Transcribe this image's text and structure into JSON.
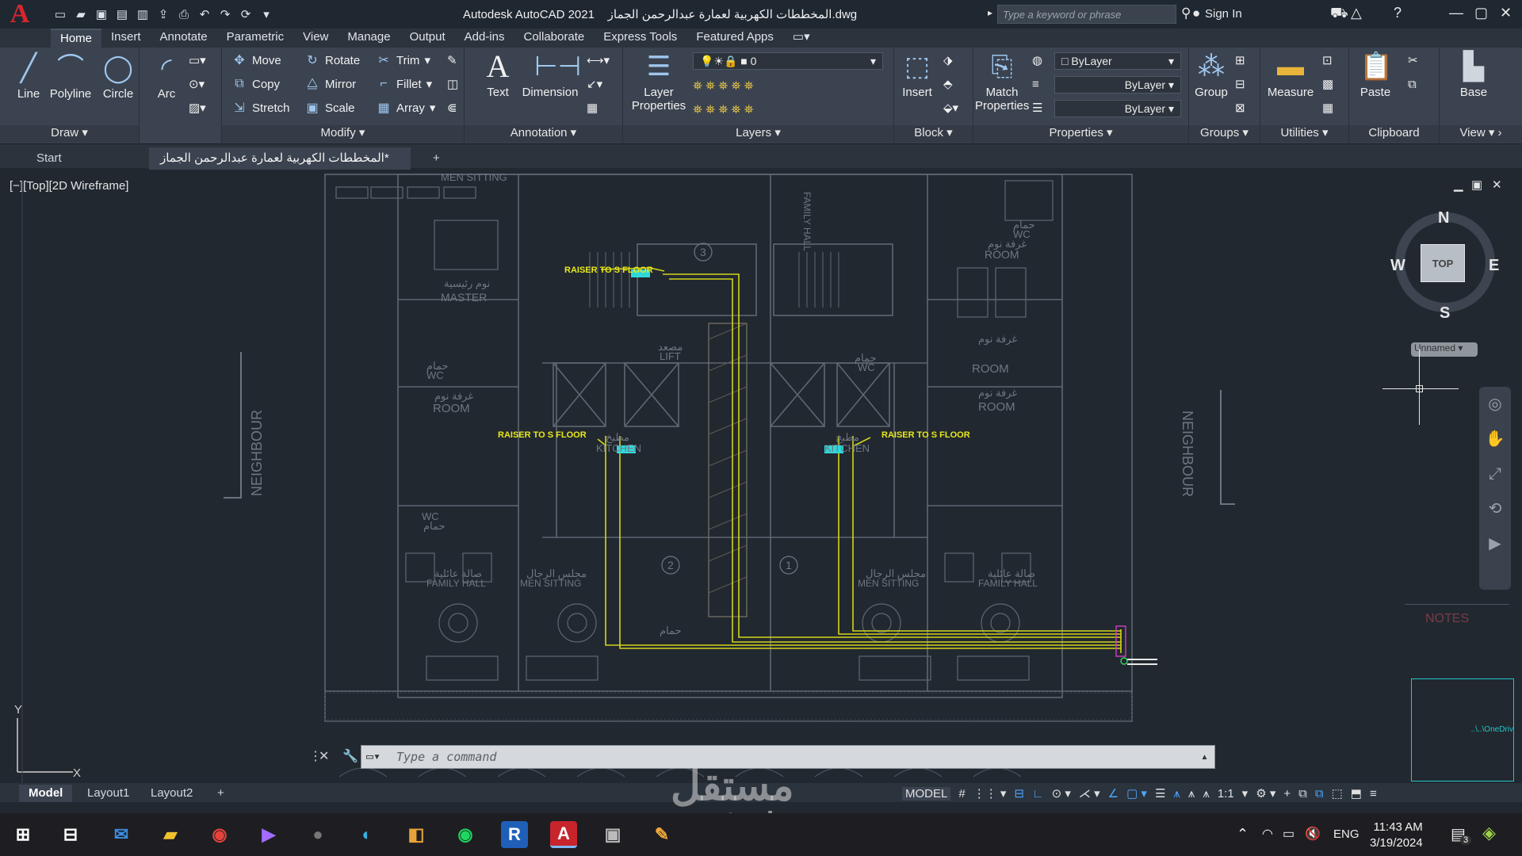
{
  "titlebar": {
    "app": "Autodesk AutoCAD 2021",
    "file": "المخططات الكهربية لعمارة عبدالرحمن الجماز.dwg",
    "search_placeholder": "Type a keyword or phrase",
    "sign_in": "Sign In"
  },
  "ribbon_tabs": [
    "Home",
    "Insert",
    "Annotate",
    "Parametric",
    "View",
    "Manage",
    "Output",
    "Add-ins",
    "Collaborate",
    "Express Tools",
    "Featured Apps"
  ],
  "ribbon": {
    "draw": {
      "label": "Draw",
      "tools": [
        "Line",
        "Polyline",
        "Circle",
        "Arc"
      ]
    },
    "modify": {
      "label": "Modify",
      "tools": [
        "Move",
        "Rotate",
        "Trim",
        "Copy",
        "Mirror",
        "Fillet",
        "Stretch",
        "Scale",
        "Array"
      ]
    },
    "annotation": {
      "label": "Annotation",
      "tools": [
        "Text",
        "Dimension"
      ]
    },
    "layers": {
      "label": "Layers",
      "tool": "Layer Properties",
      "current_layer": "0"
    },
    "block": {
      "label": "Block",
      "tool": "Insert"
    },
    "properties": {
      "label": "Properties",
      "tool": "Match Properties",
      "color": "ByLayer",
      "linetype": "ByLayer",
      "lineweight": "ByLayer"
    },
    "groups": {
      "label": "Groups",
      "tool": "Group"
    },
    "utilities": {
      "label": "Utilities",
      "tool": "Measure"
    },
    "clipboard": {
      "label": "Clipboard",
      "tool": "Paste"
    },
    "view": {
      "label": "View",
      "tool": "Base"
    }
  },
  "file_tabs": {
    "start": "Start",
    "active": "المخططات الكهربية لعمارة عبدالرحمن الجماز*"
  },
  "viewport": {
    "label": "[−][Top][2D Wireframe]",
    "viewcube": {
      "n": "N",
      "s": "S",
      "e": "E",
      "w": "W",
      "top": "TOP",
      "ucs": "Unnamed"
    },
    "drawing_texts": {
      "men_sitting_top": "MEN SITTING",
      "master": "MASTER",
      "master_ar": "نوم رئيسية",
      "wc": "WC",
      "wc_ar": "حمام",
      "room": "ROOM",
      "room_ar": "غرفة نوم",
      "kitchen": "KITCHEN",
      "kitchen_ar": "مطبخ",
      "family_hall": "FAMILY HALL",
      "family_hall_ar": "صالة عائلية",
      "men_sitting": "MEN SITTING",
      "men_sitting_ar": "مجلس الرجال",
      "lift": "LIFT",
      "lift_ar": "مصعد",
      "neighbour": "NEIGHBOUR",
      "raiser": "RAISER TO S FLOOR",
      "n1": "1",
      "n2": "2",
      "n3": "3",
      "notes": "NOTES",
      "onedrive": "..\\..\\OneDriv"
    }
  },
  "command": {
    "placeholder": "Type a command"
  },
  "layout_tabs": [
    "Model",
    "Layout1",
    "Layout2"
  ],
  "status": {
    "model": "MODEL",
    "scale": "1:1"
  },
  "taskbar": {
    "lang": "ENG",
    "time": "11:43 AM",
    "date": "3/19/2024",
    "notif": "3"
  },
  "watermark": {
    "ar": "مستقل",
    "en": "mostaql.com"
  }
}
